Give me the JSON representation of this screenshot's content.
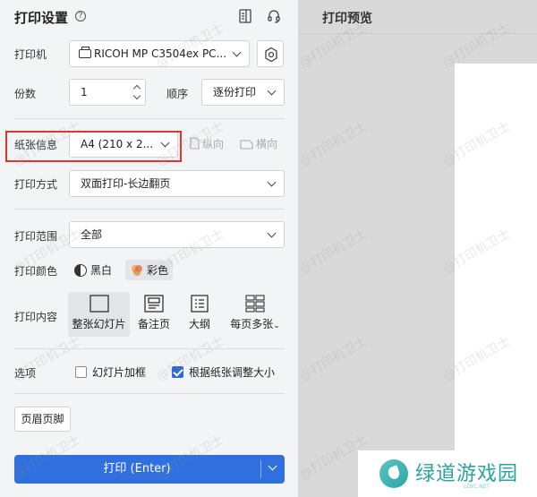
{
  "settings": {
    "title": "打印设置",
    "help_glyph": "?",
    "printer_label": "打印机",
    "printer_value": "RICOH MP C3504ex PC...",
    "copies_label": "份数",
    "copies_value": "1",
    "order_label": "顺序",
    "order_value": "逐份打印",
    "paper_label": "纸张信息",
    "paper_value": "A4 (210 x 2...",
    "portrait_label": "纵向",
    "landscape_label": "横向",
    "duplex_label": "打印方式",
    "duplex_value": "双面打印-长边翻页",
    "range_label": "打印范围",
    "range_value": "全部",
    "color_label": "打印颜色",
    "color_options": [
      "黑白",
      "彩色"
    ],
    "content_label": "打印内容",
    "content_options": [
      "整张幻灯片",
      "备注页",
      "大纲",
      "每页多张"
    ],
    "options_label": "选项",
    "checkbox_frame": "幻灯片加框",
    "checkbox_frame_checked": false,
    "checkbox_fit": "根据纸张调整大小",
    "checkbox_fit_checked": true,
    "header_footer_button": "页眉页脚",
    "print_button": "打印 (Enter)"
  },
  "preview": {
    "title": "打印预览"
  },
  "watermark": "@打印机卫士",
  "logo": {
    "text": "绿道游戏园",
    "sub": "LDYC.NET"
  },
  "colors": {
    "accent": "#2f6fde",
    "highlight_border": "#e1342b",
    "logo": "#2aa39f"
  }
}
